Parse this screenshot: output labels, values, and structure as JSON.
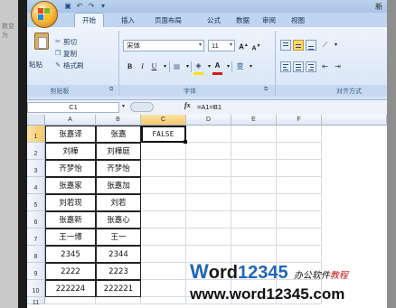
{
  "app": {
    "title_fragment": "新",
    "background_fragment": "数变为"
  },
  "ribbon": {
    "tabs": [
      "开始",
      "插入",
      "页面布局",
      "公式",
      "数据",
      "审阅",
      "视图"
    ],
    "clipboard": {
      "paste_label": "粘贴",
      "cut_label": "剪切",
      "copy_label": "复制",
      "format_painter_label": "格式刷",
      "group_label": "剪贴板"
    },
    "font": {
      "font_name": "宋体",
      "font_size": "11",
      "grow_label": "A",
      "shrink_label": "A",
      "bold_label": "B",
      "italic_label": "I",
      "underline_label": "U",
      "color_label": "A",
      "phonetic_label": "变",
      "group_label": "字体"
    },
    "alignment": {
      "group_label": "对齐方式"
    }
  },
  "formula_bar": {
    "name_box": "C1",
    "fx_label": "fx",
    "formula": "=A1=B1"
  },
  "sheet": {
    "columns": [
      "A",
      "B",
      "C",
      "D",
      "E",
      "F"
    ],
    "row_numbers": [
      "1",
      "2",
      "3",
      "4",
      "5",
      "6",
      "7",
      "8",
      "9",
      "10",
      "11"
    ],
    "rows": [
      [
        "张嘉译",
        "张嘉",
        "FALSE"
      ],
      [
        "刘樺",
        "刘樺庭",
        ""
      ],
      [
        "齐梦怡",
        "齐梦怡",
        ""
      ],
      [
        "张嘉家",
        "张嘉加",
        ""
      ],
      [
        "刘若现",
        "刘若",
        ""
      ],
      [
        "张嘉新",
        "张嘉心",
        ""
      ],
      [
        "王一博",
        "王一",
        ""
      ],
      [
        "2345",
        "2344",
        ""
      ],
      [
        "2222",
        "2223",
        ""
      ],
      [
        "222224",
        "222221",
        ""
      ]
    ],
    "active_cell": "C1"
  },
  "watermark": {
    "w": "W",
    "ord": "ord",
    "num": "12345",
    "cn_a": "办公软件",
    "cn_b": "教程",
    "url": "www.word12345.com"
  },
  "colors": {
    "ribbon_bg": "#dbe7f7",
    "tab_bar": "#bfd5f0",
    "active_header": "#f5c86a",
    "watermark_blue": "#1f66b8",
    "watermark_red": "#c4161c"
  }
}
